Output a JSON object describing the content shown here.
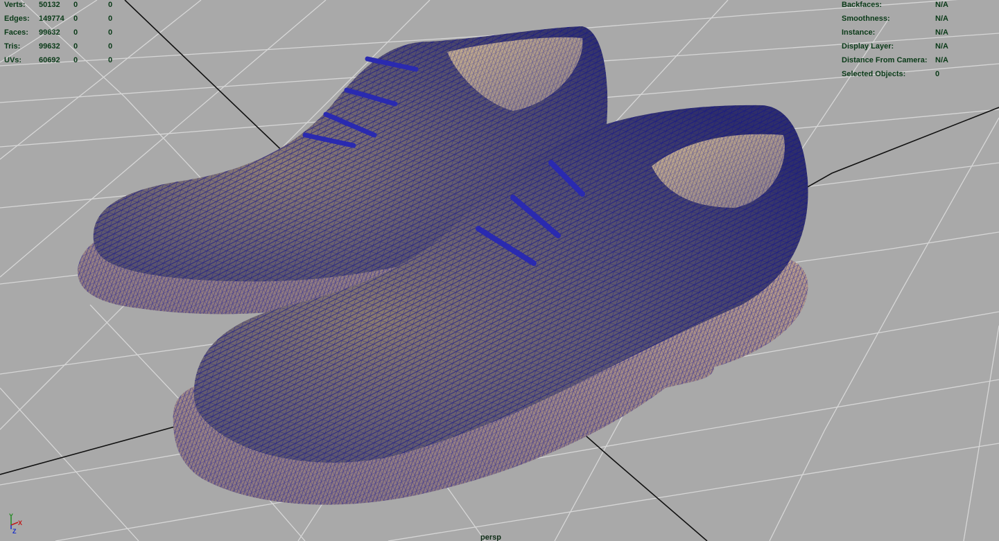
{
  "viewport": {
    "camera": "persp",
    "background_color": "#a9a9a9",
    "grid_color": "#d5d5d5",
    "axis_line_color": "#111111",
    "wireframe_color": "#16168a"
  },
  "heads_up_left": {
    "rows": [
      {
        "label": "Verts:",
        "total": "50132",
        "selected": "0",
        "uv": "0"
      },
      {
        "label": "Edges:",
        "total": "149774",
        "selected": "0",
        "uv": "0"
      },
      {
        "label": "Faces:",
        "total": "99632",
        "selected": "0",
        "uv": "0"
      },
      {
        "label": "Tris:",
        "total": "99632",
        "selected": "0",
        "uv": "0"
      },
      {
        "label": "UVs:",
        "total": "60692",
        "selected": "0",
        "uv": "0"
      }
    ]
  },
  "heads_up_right": {
    "rows": [
      {
        "label": "Backfaces:",
        "value": "N/A"
      },
      {
        "label": "Smoothness:",
        "value": "N/A"
      },
      {
        "label": "Instance:",
        "value": "N/A"
      },
      {
        "label": "Display Layer:",
        "value": "N/A"
      },
      {
        "label": "Distance From Camera:",
        "value": "N/A"
      },
      {
        "label": "Selected Objects:",
        "value": "0"
      }
    ]
  },
  "axis": {
    "x": "X",
    "y": "Y",
    "z": "Z"
  }
}
